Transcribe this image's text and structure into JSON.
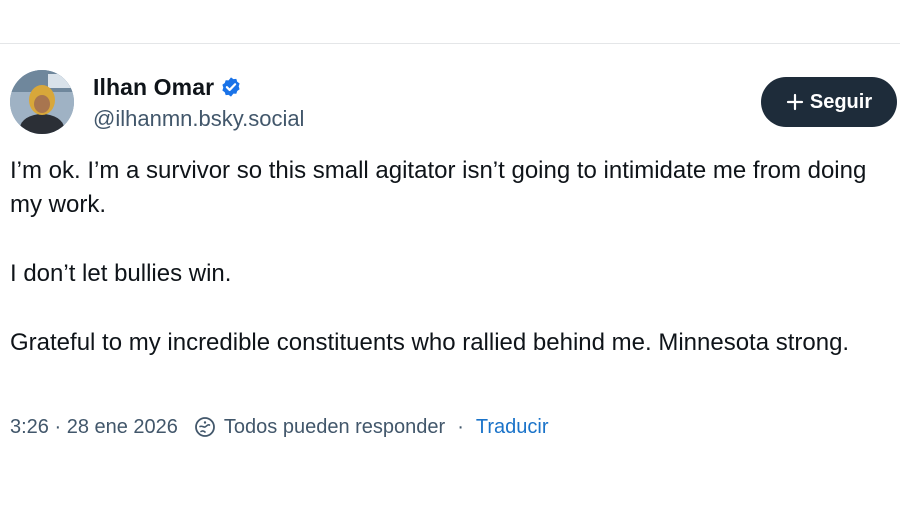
{
  "author": {
    "display_name": "Ilhan Omar",
    "handle": "@ilhanmn.bsky.social",
    "verified_icon": "verified-check-icon",
    "avatar_icon": "profile-photo"
  },
  "follow_button": {
    "label": "Seguir",
    "icon": "plus-icon"
  },
  "post": {
    "paragraphs": [
      "I’m ok. I’m a survivor so this small agitator isn’t going to intimidate me from doing my work.",
      "I don’t let bullies win.",
      "Grateful to my incredible constituents who rallied behind me. Minnesota strong."
    ]
  },
  "meta": {
    "timestamp": "3:26 · 28 ene 2026",
    "reply_setting": "Todos pueden responder",
    "reply_icon": "reply-permission-icon",
    "separator": "·",
    "translate_label": "Traducir"
  },
  "colors": {
    "button_bg": "#1e2c3a",
    "verified_blue": "#1a73e8",
    "link_blue": "#1a73c9",
    "muted_text": "#42576b"
  }
}
